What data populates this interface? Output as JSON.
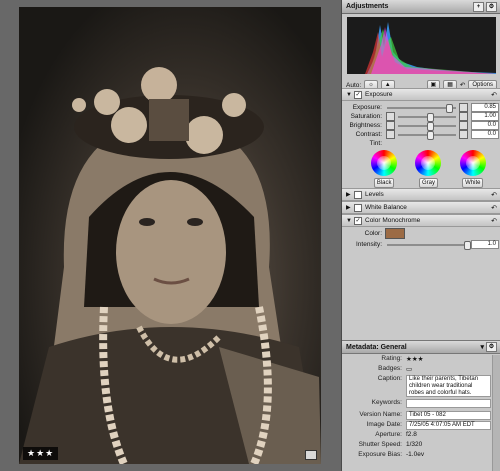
{
  "viewer": {
    "rating_stars": "★★★",
    "photo_alt_name": "portrait-photo"
  },
  "panel": {
    "title": "Adjustments",
    "add_button": "+",
    "menu_button": "⚙",
    "auto_label": "Auto:",
    "options_label": "Options",
    "exposure": {
      "title": "Exposure",
      "rows": [
        {
          "label": "Exposure:",
          "value": "0.85"
        },
        {
          "label": "Saturation:",
          "value": "1.00"
        },
        {
          "label": "Brightness:",
          "value": "0.0"
        },
        {
          "label": "Contrast:",
          "value": "0.0"
        }
      ],
      "tint_label": "Tint:",
      "tint_buttons": [
        "Black",
        "Gray",
        "White"
      ]
    },
    "levels": {
      "title": "Levels"
    },
    "white_balance": {
      "title": "White Balance"
    },
    "color_mono": {
      "title": "Color Monochrome",
      "color_label": "Color:",
      "intensity_label": "Intensity:",
      "intensity_value": "1.0",
      "color_hex": "#9c6b45"
    }
  },
  "metadata": {
    "title": "Metadata: General",
    "rows": [
      {
        "key": "Rating:",
        "value": "★★★"
      },
      {
        "key": "Badges:",
        "value": "▭"
      },
      {
        "key": "Caption:",
        "value": "Like their parents, Tibetan children wear traditional robes and colorful hats."
      },
      {
        "key": "Keywords:",
        "value": ""
      },
      {
        "key": "Version Name:",
        "value": "Tibet 05 - 082"
      },
      {
        "key": "Image Date:",
        "value": "7/25/05 4:07:05 AM EDT"
      },
      {
        "key": "Aperture:",
        "value": "f2.8"
      },
      {
        "key": "Shutter Speed:",
        "value": "1/320"
      },
      {
        "key": "Exposure Bias:",
        "value": "-1.0ev"
      }
    ]
  }
}
